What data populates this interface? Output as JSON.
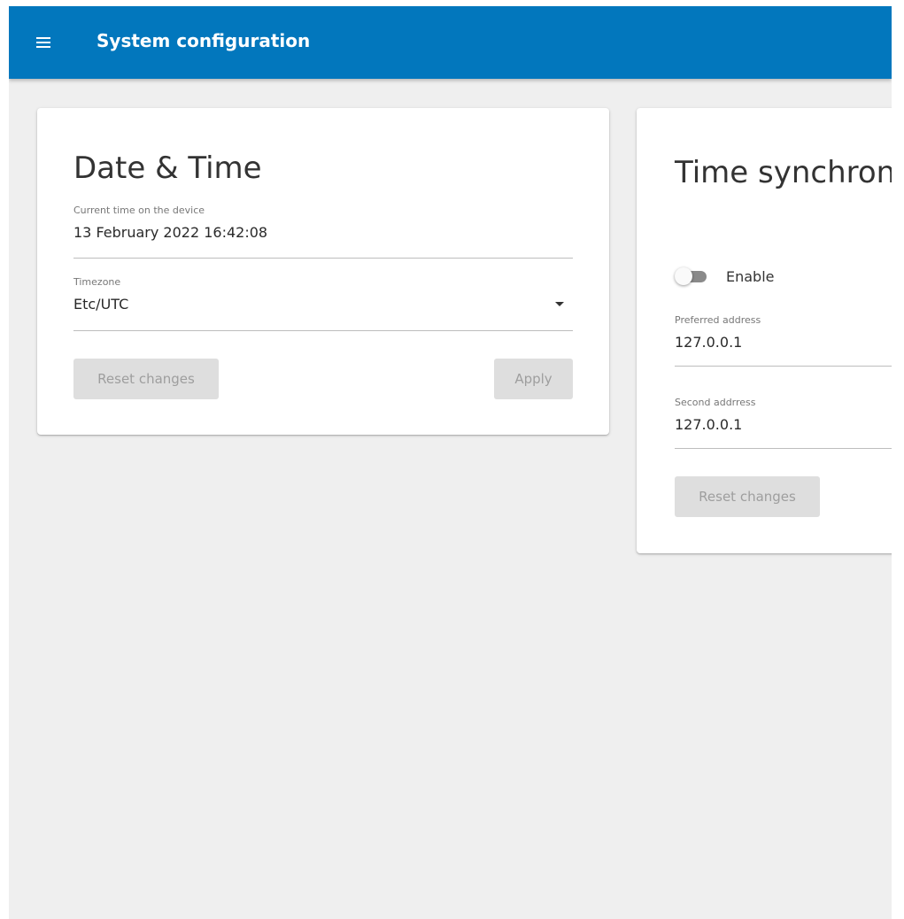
{
  "app_bar": {
    "title": "System configuration",
    "menu_icon": "menu-icon",
    "color": "#0277bd"
  },
  "date_time_card": {
    "title": "Date & Time",
    "current_time": {
      "label": "Current time on the device",
      "value": "13 February 2022 16:42:08"
    },
    "timezone": {
      "label": "Timezone",
      "value": "Etc/UTC",
      "icon": "dropdown-arrow-icon"
    },
    "reset_label": "Reset changes",
    "apply_label": "Apply"
  },
  "ntp_card": {
    "title": "Time synchronization NTP",
    "enable": {
      "label": "Enable",
      "state": false
    },
    "preferred_address": {
      "label": "Preferred address",
      "value": "127.0.0.1"
    },
    "second_address": {
      "label": "Second addrress",
      "value": "127.0.0.1"
    },
    "reset_label": "Reset changes"
  },
  "colors": {
    "app_bar": "#0277bd",
    "background": "#efefef",
    "disabled_button": "#dedede",
    "disabled_text": "#9e9e9e"
  }
}
